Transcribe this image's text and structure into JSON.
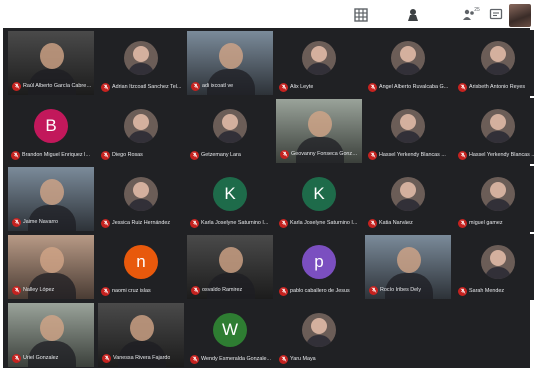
{
  "toolbar": {
    "grid_icon": "grid-view-icon",
    "people_icon": "people-icon",
    "people_count": "25",
    "chat_icon": "chat-icon",
    "activities_icon": "activities-icon"
  },
  "colors": {
    "background": "#202124",
    "mute": "#c5221f",
    "active_outline": "#8ab4f8",
    "avatar_B": "#c2185b",
    "avatar_K": "#1e6b4a",
    "avatar_n": "#e8590c",
    "avatar_p": "#7b4fc0",
    "avatar_W": "#2e7d32"
  },
  "participants": [
    {
      "name": "Raúl Alberto García Cabrer...",
      "kind": "video"
    },
    {
      "name": "Adrian Itzcoatl Sanchez Tel...",
      "kind": "photo"
    },
    {
      "name": "adi ixcoatl ve",
      "kind": "video"
    },
    {
      "name": "Alix Leyte",
      "kind": "photo"
    },
    {
      "name": "Angel Alberto Ruvalcaba G...",
      "kind": "photo"
    },
    {
      "name": "Arisbeth Antonio Reyes",
      "kind": "photo"
    },
    {
      "name": "Brandon Miguel Enriquez I...",
      "kind": "initial",
      "initial": "B"
    },
    {
      "name": "Diego Rosas",
      "kind": "photo"
    },
    {
      "name": "Getzemany Lara",
      "kind": "photo"
    },
    {
      "name": "Geovanny Fonseca Gonzalez",
      "kind": "video",
      "active": true
    },
    {
      "name": "Hassel Yerkendy Blancas ...",
      "kind": "photo"
    },
    {
      "name": "Hassel Yerkendy Blancas ...",
      "kind": "photo"
    },
    {
      "name": "Jaime Navarro",
      "kind": "video"
    },
    {
      "name": "Jessica Ruiz Hernández",
      "kind": "photo"
    },
    {
      "name": "Karla Joselyne Saturnino I...",
      "kind": "initial",
      "initial": "K"
    },
    {
      "name": "Karla Joselyne Saturnino I...",
      "kind": "initial",
      "initial": "K"
    },
    {
      "name": "Katia Narváez",
      "kind": "photo"
    },
    {
      "name": "miguel gamez",
      "kind": "photo"
    },
    {
      "name": "Nalley López",
      "kind": "video"
    },
    {
      "name": "naomi cruz islas",
      "kind": "initial",
      "initial": "n"
    },
    {
      "name": "osvaldo Ramirez",
      "kind": "video"
    },
    {
      "name": "pablo caballero de Jesus",
      "kind": "initial",
      "initial": "p"
    },
    {
      "name": "Rocío Iribes Dely",
      "kind": "video"
    },
    {
      "name": "Sarah Mendez",
      "kind": "photo"
    },
    {
      "name": "Uriel Gonzalez",
      "kind": "video"
    },
    {
      "name": "Vanessa Rivera Fajardo",
      "kind": "video"
    },
    {
      "name": "Wendy Esmeralda Gonzale...",
      "kind": "initial",
      "initial": "W"
    },
    {
      "name": "Yaru Maya",
      "kind": "photo"
    }
  ]
}
